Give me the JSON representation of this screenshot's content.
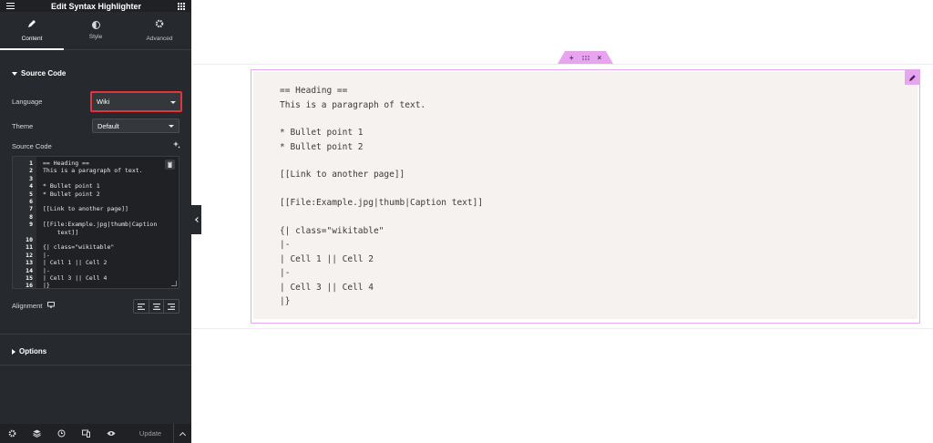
{
  "header": {
    "title": "Edit Syntax Highlighter"
  },
  "tabs": [
    {
      "label": "Content",
      "icon": "pencil-icon",
      "active": true
    },
    {
      "label": "Style",
      "icon": "half-circle-icon",
      "active": false
    },
    {
      "label": "Advanced",
      "icon": "gear-icon",
      "active": false
    }
  ],
  "source_section": {
    "title": "Source Code",
    "language_label": "Language",
    "language_value": "Wiki",
    "theme_label": "Theme",
    "theme_value": "Default",
    "code_label": "Source Code",
    "alignment_label": "Alignment"
  },
  "code_lines": [
    {
      "n": "1",
      "t": "== Heading =="
    },
    {
      "n": "2",
      "t": "This is a paragraph of text."
    },
    {
      "n": "3",
      "t": ""
    },
    {
      "n": "4",
      "t": "* Bullet point 1"
    },
    {
      "n": "5",
      "t": "* Bullet point 2"
    },
    {
      "n": "6",
      "t": ""
    },
    {
      "n": "7",
      "t": "[[Link to another page]]"
    },
    {
      "n": "8",
      "t": ""
    },
    {
      "n": "9",
      "t": "[[File:Example.jpg|thumb|Caption"
    },
    {
      "n": "",
      "t": "    text]]"
    },
    {
      "n": "10",
      "t": ""
    },
    {
      "n": "11",
      "t": "{| class=\"wikitable\""
    },
    {
      "n": "12",
      "t": "|-"
    },
    {
      "n": "13",
      "t": "| Cell 1 || Cell 2"
    },
    {
      "n": "14",
      "t": "|-"
    },
    {
      "n": "15",
      "t": "| Cell 3 || Cell 4"
    },
    {
      "n": "16",
      "t": "|}"
    }
  ],
  "options_section": {
    "title": "Options"
  },
  "footer": {
    "update_label": "Update"
  },
  "rendered_lines": [
    "== Heading ==",
    "This is a paragraph of text.",
    "* Bullet point 1",
    "* Bullet point 2",
    "[[Link to another page]]",
    "[[File:Example.jpg|thumb|Caption text]]",
    "{| class=\"wikitable\"",
    "|-",
    "| Cell 1 || Cell 2",
    "|-",
    "| Cell 3 || Cell 4",
    "|}"
  ],
  "colors": {
    "accent": "#e8a5ef",
    "highlight_border": "#e0353b",
    "panel": "#26292d"
  }
}
